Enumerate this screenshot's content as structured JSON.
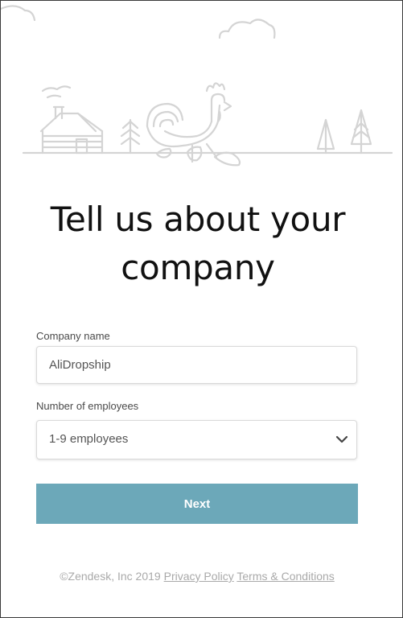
{
  "headline": {
    "line1": "Tell us about your",
    "line2": "company"
  },
  "form": {
    "company_name": {
      "label": "Company name",
      "value": "AliDropship"
    },
    "employees": {
      "label": "Number of employees",
      "selected": "1-9 employees"
    },
    "next_label": "Next"
  },
  "footer": {
    "copyright": "©Zendesk, Inc 2019",
    "privacy_link": "Privacy Policy",
    "terms_link": "Terms & Conditions"
  },
  "colors": {
    "button": "#6ca8b9",
    "illustration_stroke": "#d4d4d4",
    "footer_text": "#a9a9a9"
  },
  "icons": {
    "illustration": "farm-rooster-illustration",
    "select_arrow": "chevron-down-icon"
  }
}
